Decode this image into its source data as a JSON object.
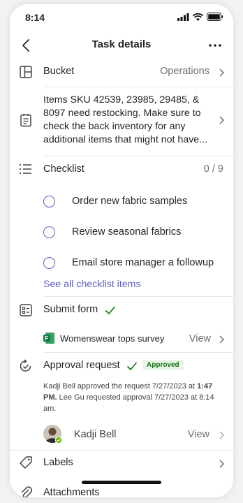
{
  "status": {
    "time": "8:14"
  },
  "header": {
    "title": "Task details"
  },
  "bucket": {
    "label": "Bucket",
    "value": "Operations"
  },
  "notes": {
    "text": "Items SKU 42539, 23985, 29485, & 8097 need restocking. Make sure to check the back inventory for any additional items that might not have..."
  },
  "checklist": {
    "label": "Checklist",
    "count": "0 / 9",
    "items": [
      {
        "label": "Order new fabric samples"
      },
      {
        "label": "Review seasonal fabrics"
      },
      {
        "label": "Email store manager a followup"
      }
    ],
    "see_all": "See all checklist items"
  },
  "form": {
    "label": "Submit form",
    "survey_name": "Womenswear tops survey",
    "view_label": "View"
  },
  "approval": {
    "label": "Approval request",
    "badge": "Approved",
    "line1": "Kadji Bell approved the request 7/27/2023 at",
    "line1_bold": "1:47 PM.",
    "line1_rest": "Lee Gu requested approval 7/27/2023 at 8:14 am.",
    "approver": "Kadji Bell",
    "view_label": "View"
  },
  "labels": {
    "label": "Labels"
  },
  "attachments": {
    "label": "Attachments"
  },
  "colors": {
    "accent": "#5b5fc7",
    "approved": "#0e700e",
    "forms_green": "#107c41"
  }
}
